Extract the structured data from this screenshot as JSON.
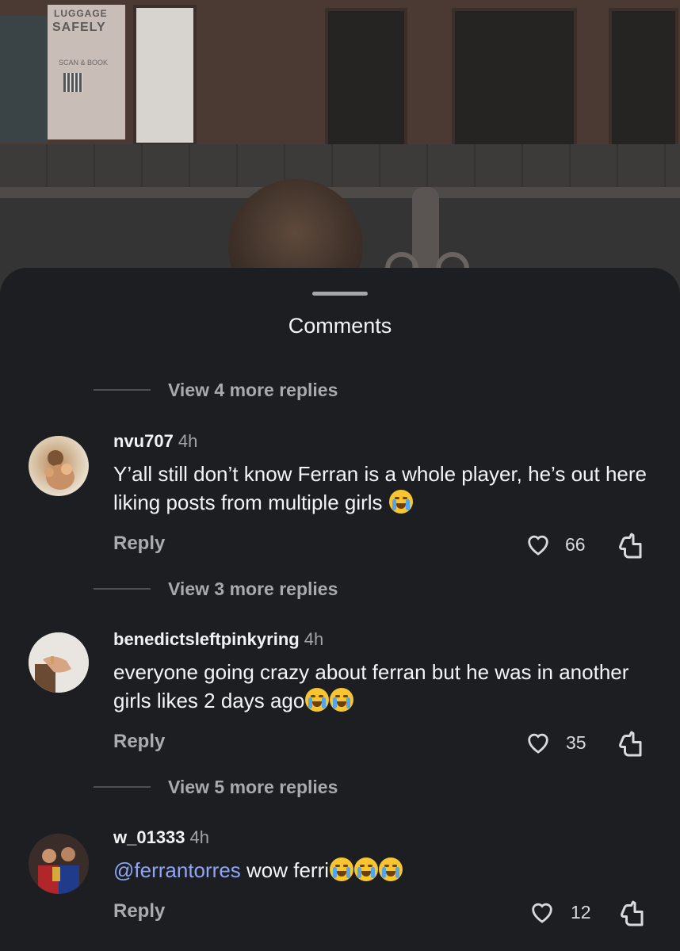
{
  "photo": {
    "sign_line1": "LUGGAGE",
    "sign_line2": "SAFELY",
    "sign_line3": "SCAN & BOOK"
  },
  "sheet": {
    "title": "Comments"
  },
  "threads": [
    {
      "more_replies_label": "View 4 more replies",
      "comment": {
        "username": "nvu707",
        "time": "4h",
        "text": "Y’all still don’t know Ferran is a whole player, he’s out here liking posts from multiple girls",
        "emojis": [
          "loudly-crying-face"
        ],
        "likes": "66",
        "reply_label": "Reply"
      }
    },
    {
      "more_replies_label": "View 3 more replies",
      "comment": {
        "username": "benedictsleftpinkyring",
        "time": "4h",
        "text": "everyone going crazy about ferran but he was in another girls likes 2 days ago",
        "emojis": [
          "loudly-crying-face",
          "loudly-crying-face"
        ],
        "likes": "35",
        "reply_label": "Reply"
      }
    },
    {
      "more_replies_label": "View 5 more replies",
      "comment": {
        "username": "w_01333",
        "time": "4h",
        "mention": "@ferrantorres",
        "text": " wow ferri",
        "emojis": [
          "face-with-tears-of-joy",
          "face-with-tears-of-joy",
          "face-with-tears-of-joy"
        ],
        "likes": "12",
        "reply_label": "Reply"
      }
    }
  ],
  "colors": {
    "sheet_bg": "#1c1e21",
    "text_primary": "#f3f4f5",
    "text_secondary": "#a7aaae",
    "mention": "#8ea6f5"
  }
}
